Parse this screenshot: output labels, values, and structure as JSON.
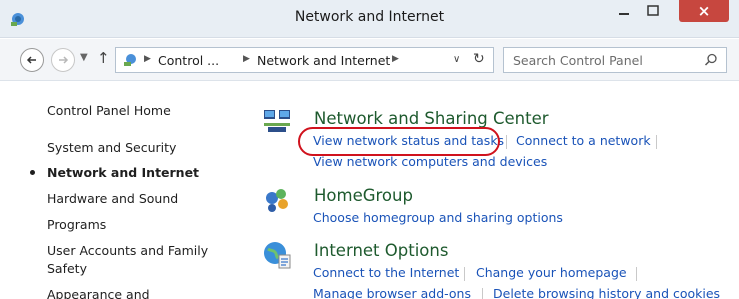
{
  "window": {
    "title": "Network and Internet",
    "close_glyph": "×",
    "accent_close": "#c7473f"
  },
  "address_bar": {
    "crumbs": [
      "Control ...",
      "Network and Internet"
    ],
    "search_placeholder": "Search Control Panel"
  },
  "left_nav": {
    "items": [
      {
        "label": "Control Panel Home"
      },
      {
        "label": "System and Security"
      },
      {
        "label": "Network and Internet",
        "active": true
      },
      {
        "label": "Hardware and Sound"
      },
      {
        "label": "Programs"
      },
      {
        "label": "User Accounts and Family"
      },
      {
        "label": "Safety"
      },
      {
        "label": "Appearance and"
      }
    ]
  },
  "categories": [
    {
      "title": "Network and Sharing Center",
      "icon": "network-sharing-icon",
      "links": [
        "View network status and tasks",
        "Connect to a network",
        "View network computers and devices"
      ]
    },
    {
      "title": "HomeGroup",
      "icon": "homegroup-icon",
      "links": [
        "Choose homegroup and sharing options"
      ]
    },
    {
      "title": "Internet Options",
      "icon": "internet-options-icon",
      "links": [
        "Connect to the Internet",
        "Change your homepage",
        "Manage browser add-ons",
        "Delete browsing history and cookies"
      ]
    }
  ],
  "colors": {
    "link": "#1a53b8",
    "heading": "#1e5a2e",
    "highlight_circle": "#d0121d"
  }
}
